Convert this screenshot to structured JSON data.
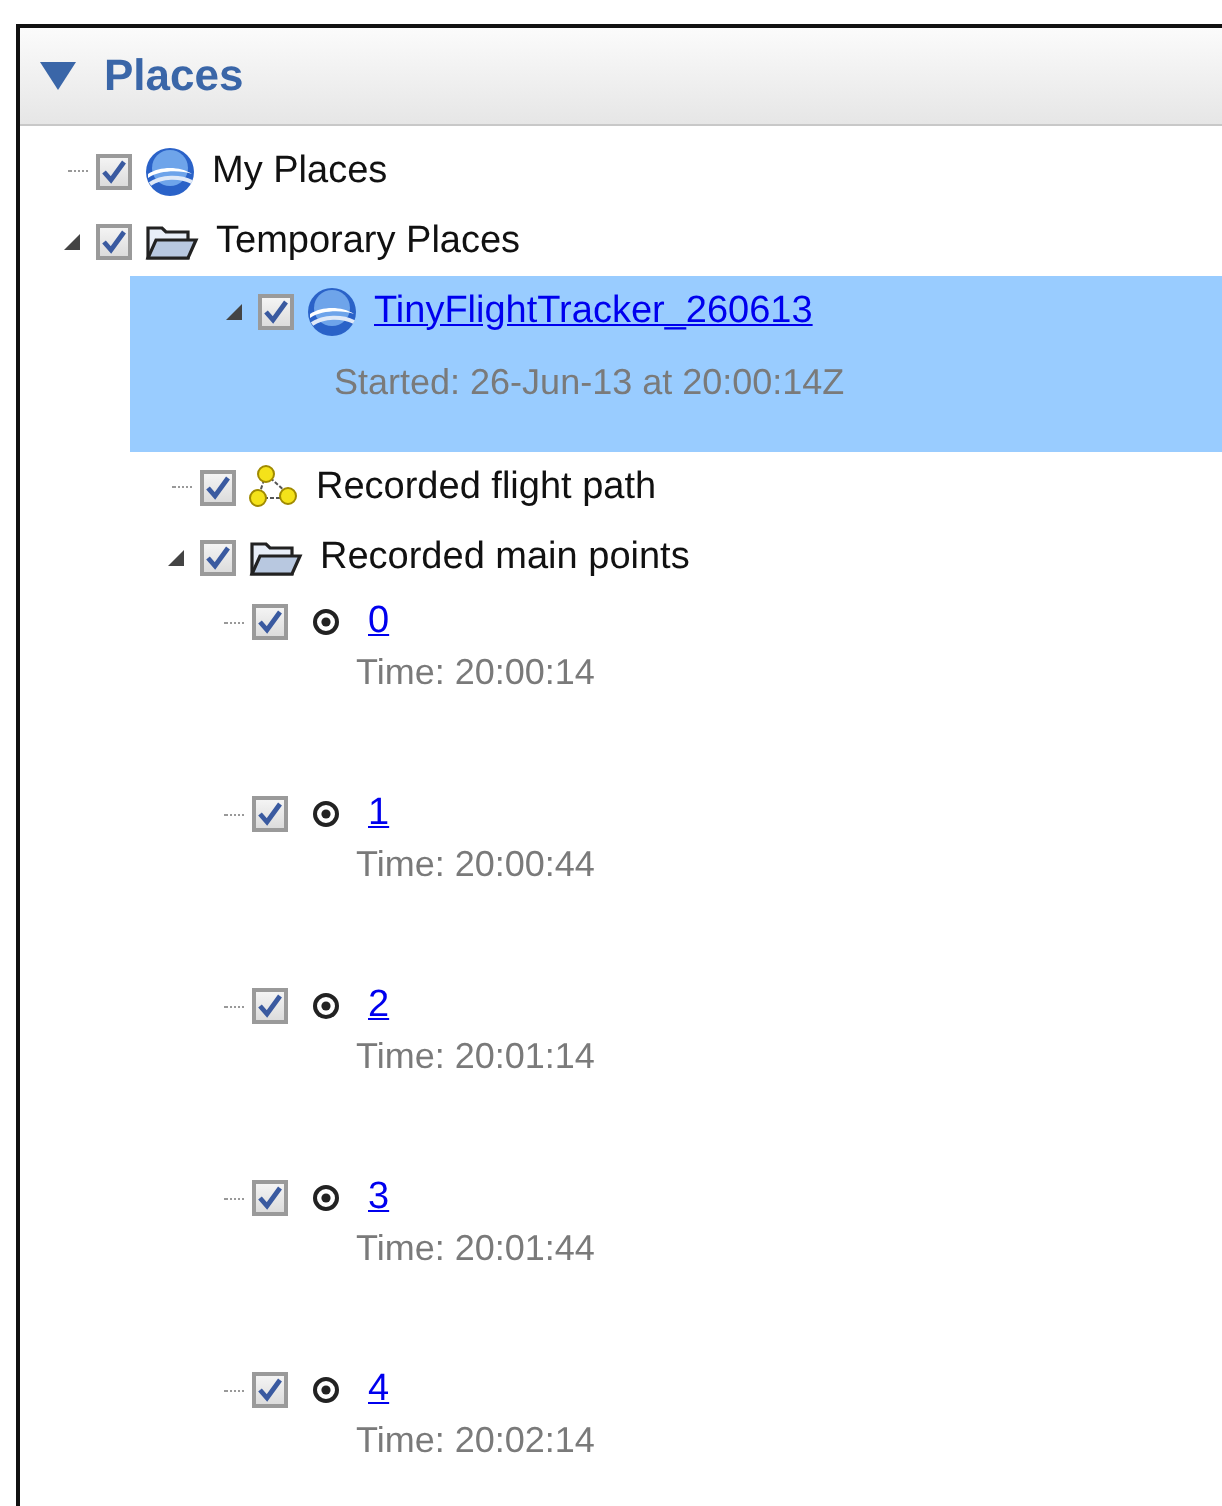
{
  "panel": {
    "title": "Places",
    "expanded": true
  },
  "tree": [
    {
      "kind": "globe",
      "label": "My Places",
      "link": false,
      "checked": true,
      "selected": false
    },
    {
      "kind": "folder",
      "label": "Temporary Places",
      "link": false,
      "checked": true,
      "selected": false,
      "expanded": true,
      "children": [
        {
          "kind": "globe",
          "label": "TinyFlightTracker_260613",
          "link": true,
          "description": "Started: 26-Jun-13 at 20:00:14Z",
          "checked": true,
          "selected": true,
          "expanded": true,
          "children": [
            {
              "kind": "path",
              "label": "Recorded flight path",
              "link": false,
              "checked": true,
              "selected": false
            },
            {
              "kind": "folder",
              "label": "Recorded main points",
              "link": false,
              "checked": true,
              "selected": false,
              "expanded": true,
              "children": [
                {
                  "kind": "point",
                  "label": "0",
                  "link": true,
                  "description": "Time: 20:00:14",
                  "checked": true,
                  "selected": false
                },
                {
                  "kind": "point",
                  "label": "1",
                  "link": true,
                  "description": "Time: 20:00:44",
                  "checked": true,
                  "selected": false
                },
                {
                  "kind": "point",
                  "label": "2",
                  "link": true,
                  "description": "Time: 20:01:14",
                  "checked": true,
                  "selected": false
                },
                {
                  "kind": "point",
                  "label": "3",
                  "link": true,
                  "description": "Time: 20:01:44",
                  "checked": true,
                  "selected": false
                },
                {
                  "kind": "point",
                  "label": "4",
                  "link": true,
                  "description": "Time: 20:02:14",
                  "checked": true,
                  "selected": false
                }
              ]
            }
          ]
        }
      ]
    }
  ]
}
